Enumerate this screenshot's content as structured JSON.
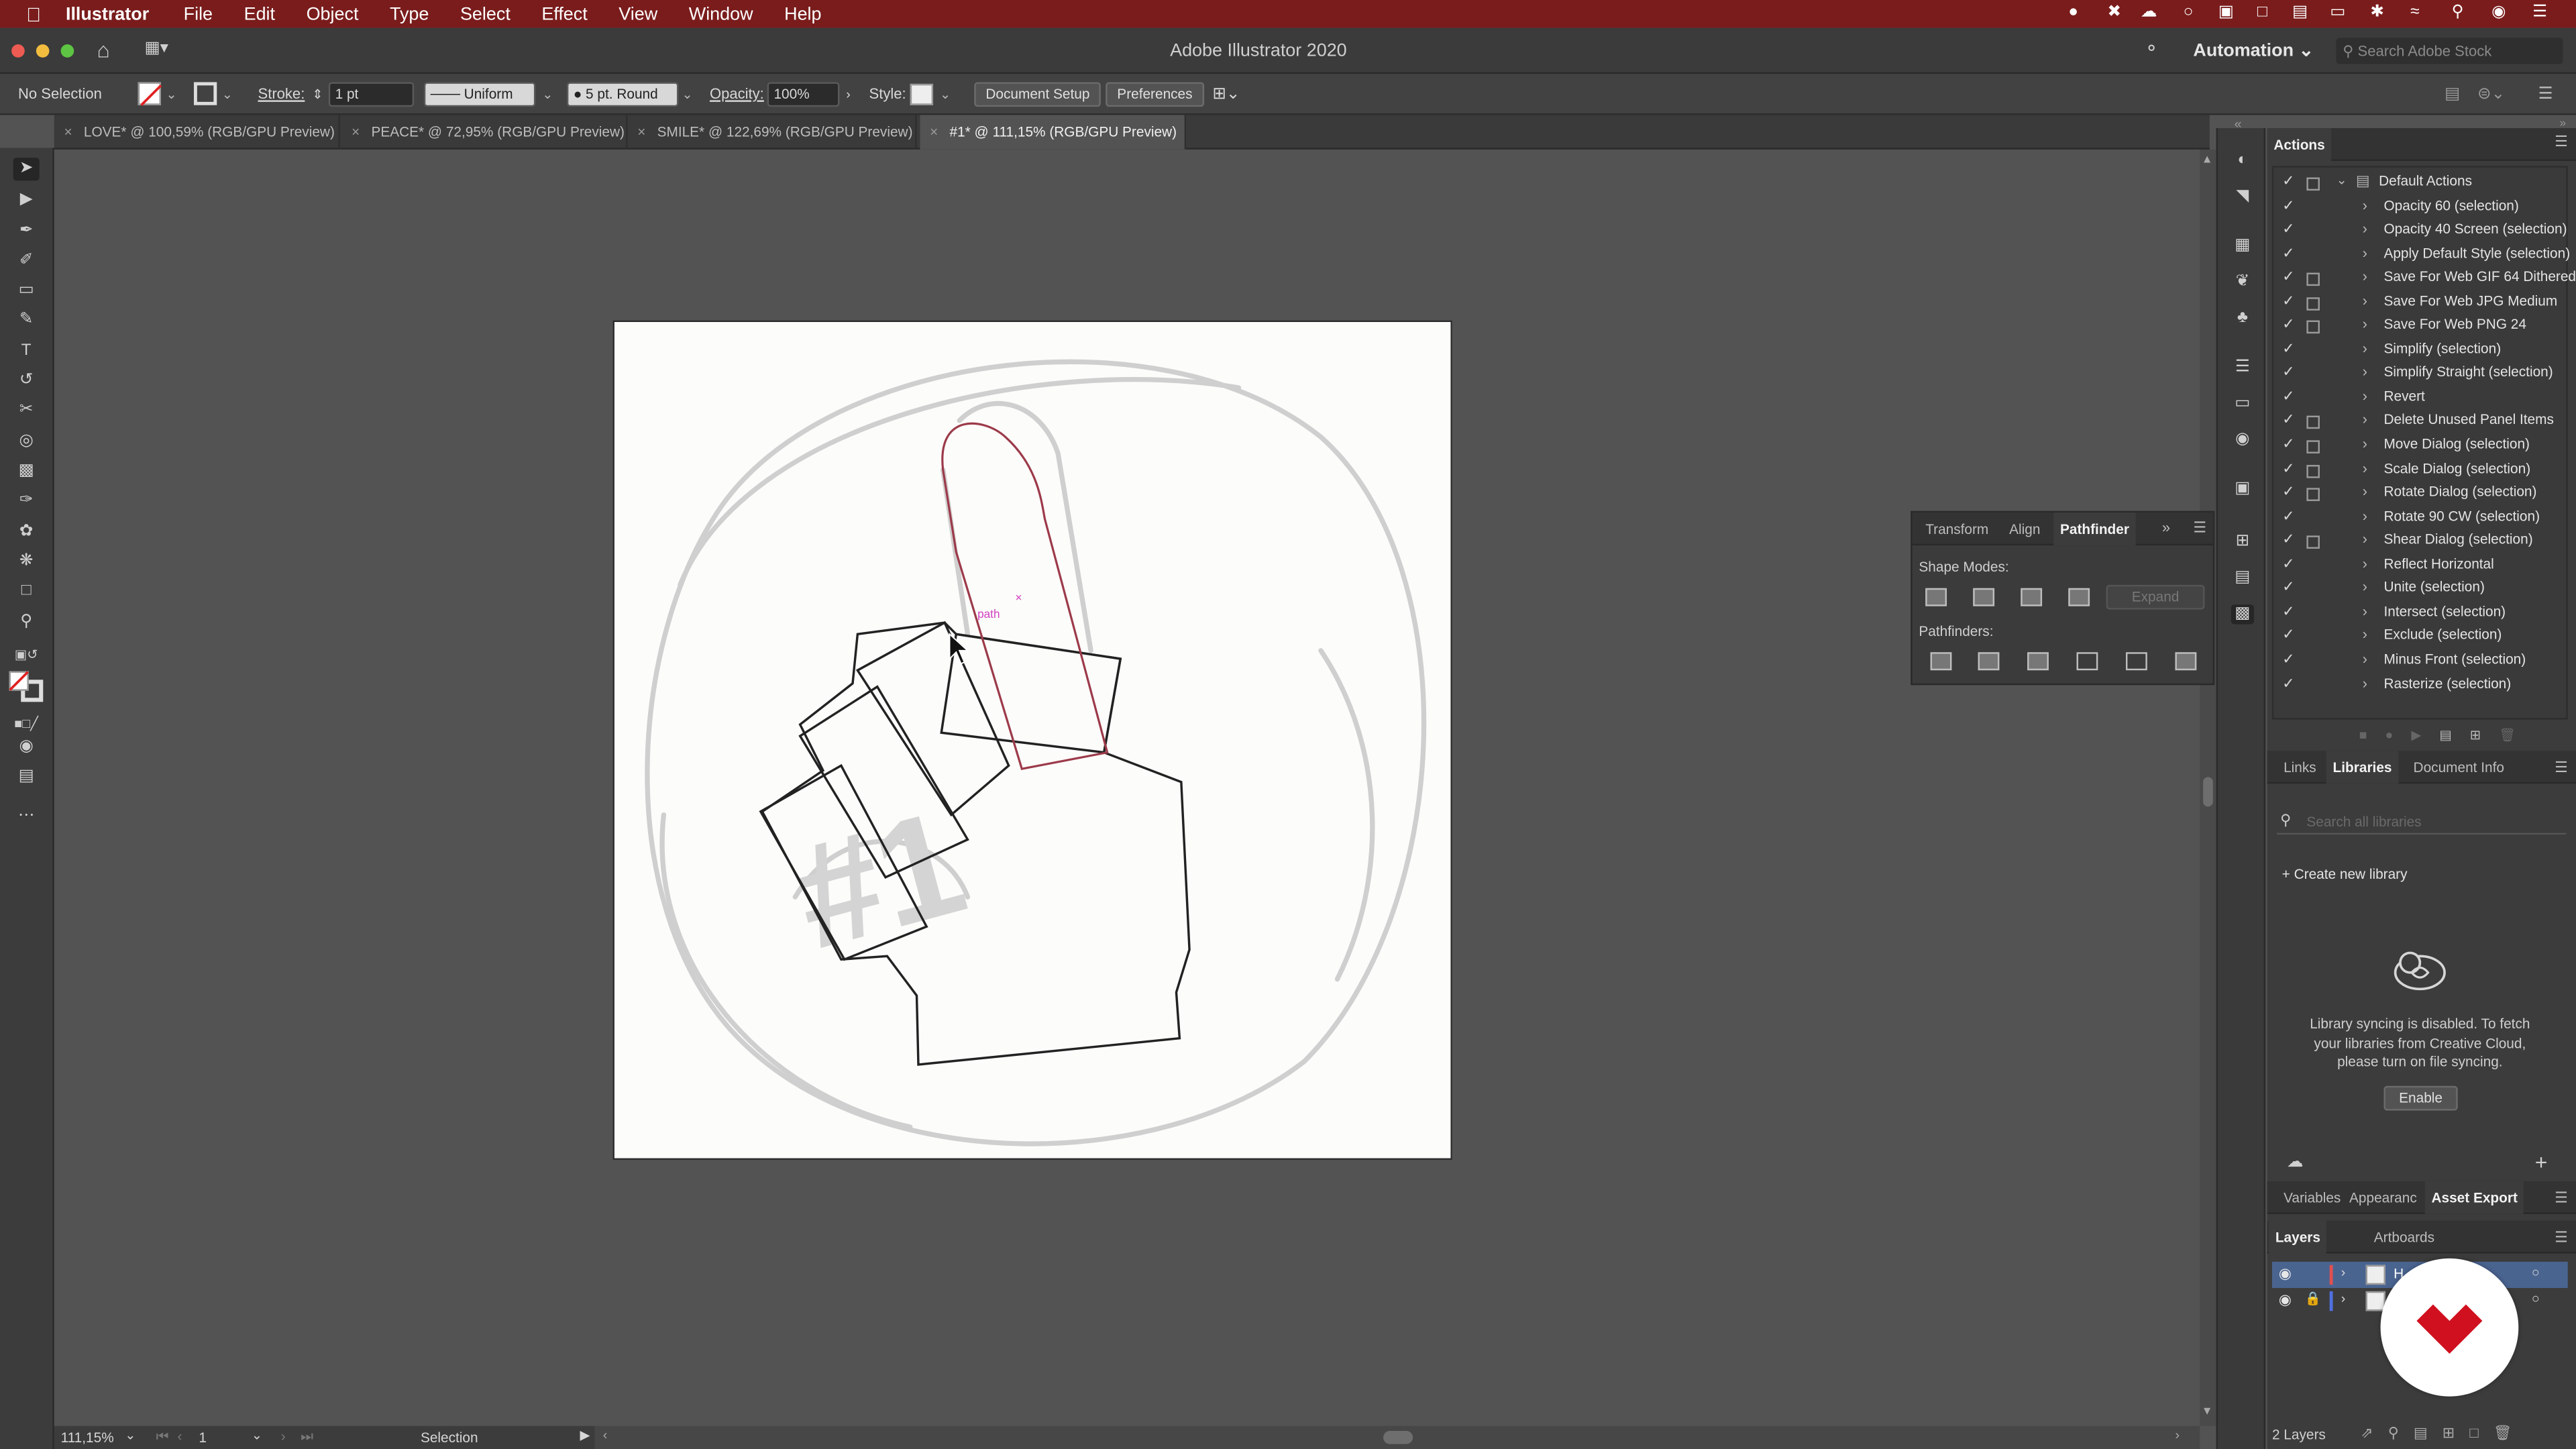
{
  "menubar": {
    "app_name": "Illustrator",
    "items": [
      "File",
      "Edit",
      "Object",
      "Type",
      "Select",
      "Effect",
      "View",
      "Window",
      "Help"
    ]
  },
  "window": {
    "title": "Adobe Illustrator 2020",
    "workspace": "Automation",
    "search_placeholder": "Search Adobe Stock"
  },
  "control_bar": {
    "selection_label": "No Selection",
    "stroke_label": "Stroke:",
    "stroke_value": "1 pt",
    "profile_value": "Uniform",
    "brush_value": "5 pt. Round",
    "opacity_label": "Opacity:",
    "opacity_value": "100%",
    "style_label": "Style:",
    "document_setup": "Document Setup",
    "preferences": "Preferences"
  },
  "tabs": [
    {
      "label": "LOVE* @ 100,59% (RGB/GPU Preview)",
      "active": false
    },
    {
      "label": "PEACE* @ 72,95% (RGB/GPU Preview)",
      "active": false
    },
    {
      "label": "SMILE* @ 122,69% (RGB/GPU Preview)",
      "active": false
    },
    {
      "label": "#1* @ 111,15% (RGB/GPU Preview)",
      "active": true
    }
  ],
  "canvas": {
    "path_label": "path",
    "sketch_text": "#1",
    "selected_stroke_color": "#9c3a4a",
    "sketch_color": "#c8c8c8"
  },
  "status_bar": {
    "zoom": "111,15%",
    "artboard": "1",
    "tool": "Selection"
  },
  "actions_panel": {
    "title": "Actions",
    "set_name": "Default Actions",
    "items": [
      {
        "label": "Opacity 60 (selection)",
        "dialog": false
      },
      {
        "label": "Opacity 40 Screen (selection)",
        "dialog": false
      },
      {
        "label": "Apply Default Style (selection)",
        "dialog": false
      },
      {
        "label": "Save For Web GIF 64 Dithered",
        "dialog": true
      },
      {
        "label": "Save For Web JPG Medium",
        "dialog": true
      },
      {
        "label": "Save For Web PNG 24",
        "dialog": true
      },
      {
        "label": "Simplify (selection)",
        "dialog": false
      },
      {
        "label": "Simplify Straight (selection)",
        "dialog": false
      },
      {
        "label": "Revert",
        "dialog": false
      },
      {
        "label": "Delete Unused Panel Items",
        "dialog": true
      },
      {
        "label": "Move Dialog (selection)",
        "dialog": true
      },
      {
        "label": "Scale Dialog (selection)",
        "dialog": true
      },
      {
        "label": "Rotate Dialog (selection)",
        "dialog": true
      },
      {
        "label": "Rotate 90 CW (selection)",
        "dialog": false
      },
      {
        "label": "Shear Dialog (selection)",
        "dialog": true
      },
      {
        "label": "Reflect Horizontal",
        "dialog": false
      },
      {
        "label": "Unite (selection)",
        "dialog": false
      },
      {
        "label": "Intersect (selection)",
        "dialog": false
      },
      {
        "label": "Exclude (selection)",
        "dialog": false
      },
      {
        "label": "Minus Front (selection)",
        "dialog": false
      },
      {
        "label": "Rasterize (selection)",
        "dialog": false
      }
    ]
  },
  "pathfinder_panel": {
    "tabs": [
      "Transform",
      "Align",
      "Pathfinder"
    ],
    "shape_modes_label": "Shape Modes:",
    "expand_label": "Expand",
    "pathfinders_label": "Pathfinders:"
  },
  "libraries_panel": {
    "tabs": [
      "Links",
      "Libraries",
      "Document Info"
    ],
    "search_placeholder": "Search all libraries",
    "create_label": "Create new library",
    "message": "Library syncing is disabled. To fetch your libraries from Creative Cloud, please turn on file syncing.",
    "enable_label": "Enable"
  },
  "asset_panel": {
    "tabs": [
      "Variables",
      "Appearanc",
      "Asset Export"
    ]
  },
  "layers_panel": {
    "tabs": [
      "Layers",
      "Artboards"
    ],
    "layer_name": "H",
    "layer_colors": [
      "#e05050",
      "#5070e0"
    ],
    "count_label": "2 Layers"
  },
  "badge": {
    "brand_color": "#d0101f",
    "icon": "heart-logo-icon"
  }
}
